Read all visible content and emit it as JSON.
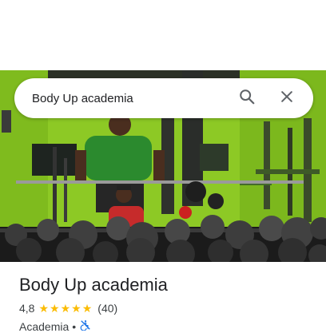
{
  "search": {
    "query": "Body Up academia"
  },
  "place": {
    "name": "Body Up academia",
    "rating": "4,8",
    "star_count": 5,
    "review_count": "(40)",
    "category": "Academia",
    "separator": "•"
  },
  "icons": {
    "search": "search-icon",
    "close": "close-icon",
    "accessibility": "no-wheelchair-accessible-icon"
  },
  "colors": {
    "star": "#fbbc04",
    "wall": "#8ccc24",
    "accessibility_icon": "#1a73e8"
  }
}
